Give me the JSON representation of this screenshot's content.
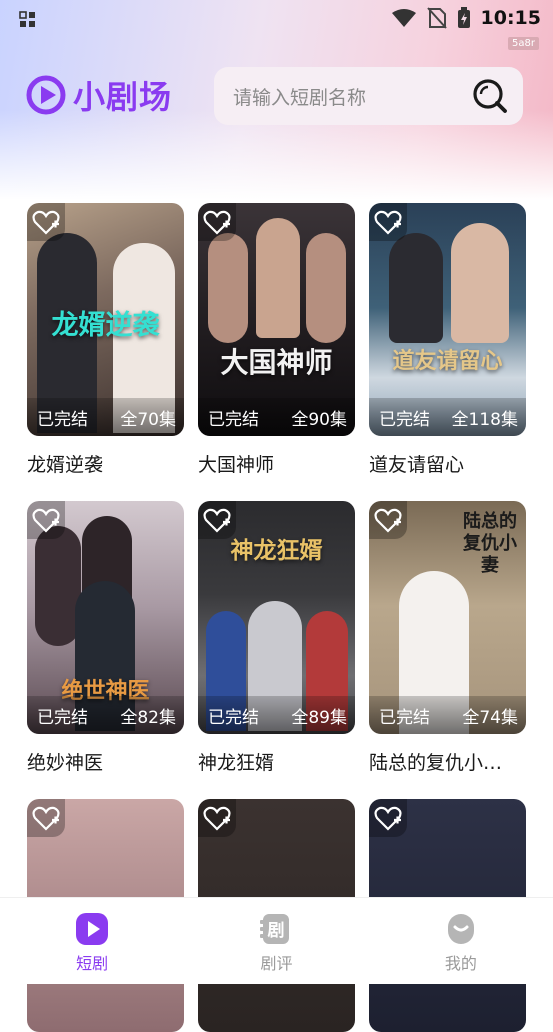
{
  "status_bar": {
    "time": "10:15",
    "badge": "5a8r"
  },
  "header": {
    "app_name": "小剧场",
    "search_placeholder": "请输入短剧名称"
  },
  "dramas": [
    {
      "title": "龙婿逆袭",
      "status": "已完结",
      "episodes": "全70集",
      "poster_text": "龙婿逆袭"
    },
    {
      "title": "大国神师",
      "status": "已完结",
      "episodes": "全90集",
      "poster_text": "大国神师"
    },
    {
      "title": "道友请留心",
      "status": "已完结",
      "episodes": "全118集",
      "poster_text": "道友请留心"
    },
    {
      "title": "绝妙神医",
      "status": "已完结",
      "episodes": "全82集",
      "poster_text": "绝世神医"
    },
    {
      "title": "神龙狂婿",
      "status": "已完结",
      "episodes": "全89集",
      "poster_text": "神龙狂婿"
    },
    {
      "title": "陆总的复仇小…",
      "status": "已完结",
      "episodes": "全74集",
      "poster_text": "陆总的复仇小妻"
    },
    {
      "title": "",
      "status": "",
      "episodes": "",
      "poster_text": ""
    },
    {
      "title": "",
      "status": "",
      "episodes": "",
      "poster_text": ""
    },
    {
      "title": "",
      "status": "",
      "episodes": "",
      "poster_text": ""
    }
  ],
  "nav": [
    {
      "label": "短剧",
      "icon": "play-icon",
      "active": true
    },
    {
      "label": "剧评",
      "icon": "review-icon",
      "active": false
    },
    {
      "label": "我的",
      "icon": "profile-icon",
      "active": false
    }
  ],
  "colors": {
    "accent": "#8a3bf0",
    "inactive": "#9a9a9a"
  }
}
